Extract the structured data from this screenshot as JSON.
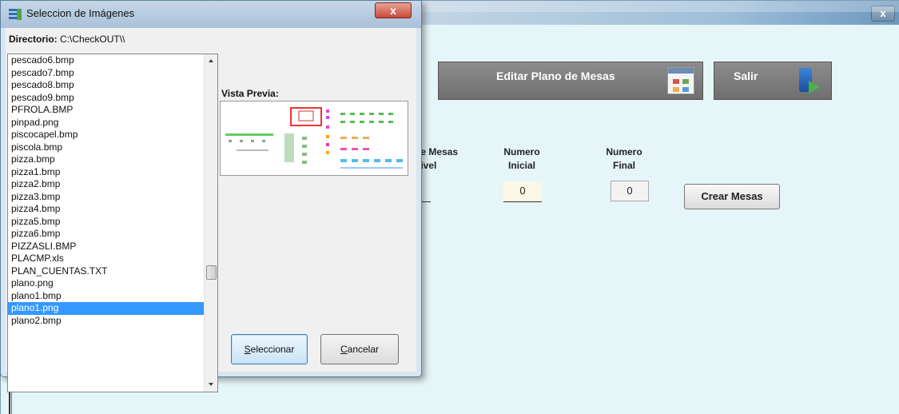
{
  "background_window": {
    "close_glyph": "x",
    "editar_button": "Editar Plano de Mesas",
    "salir_button": "Salir",
    "label_mesas": "le Mesas",
    "label_nivel": "livel",
    "label_numero_inicial_1": "Numero",
    "label_numero_inicial_2": "Inicial",
    "label_numero_final_1": "Numero",
    "label_numero_final_2": "Final",
    "numero_inicial_value": "0",
    "numero_final_value": "0",
    "crear_mesas_button": "Crear Mesas"
  },
  "dialog": {
    "title": "Seleccion de Imágenes",
    "close_glyph": "x",
    "directory_label": "Directorio:",
    "directory_value": "C:\\CheckOUT\\\\",
    "preview_label": "Vista Previa:",
    "select_button": {
      "underline": "S",
      "rest": "eleccionar"
    },
    "cancel_button": {
      "underline": "C",
      "rest": "ancelar"
    },
    "files": [
      "pescado6.bmp",
      "pescado7.bmp",
      "pescado8.bmp",
      "pescado9.bmp",
      "PFROLA.BMP",
      "pinpad.png",
      "piscocapel.bmp",
      "piscola.bmp",
      "pizza.bmp",
      "pizza1.bmp",
      "pizza2.bmp",
      "pizza3.bmp",
      "pizza4.bmp",
      "pizza5.bmp",
      "pizza6.bmp",
      "PIZZASLI.BMP",
      "PLACMP.xls",
      "PLAN_CUENTAS.TXT",
      "plano.png",
      "plano1.bmp",
      "plano1.png",
      "plano2.bmp"
    ],
    "selected_file": "plano1.png"
  },
  "colors": {
    "background": "#e6f6f8",
    "selection": "#3399ff",
    "button_gray": "#7a7a7a"
  }
}
